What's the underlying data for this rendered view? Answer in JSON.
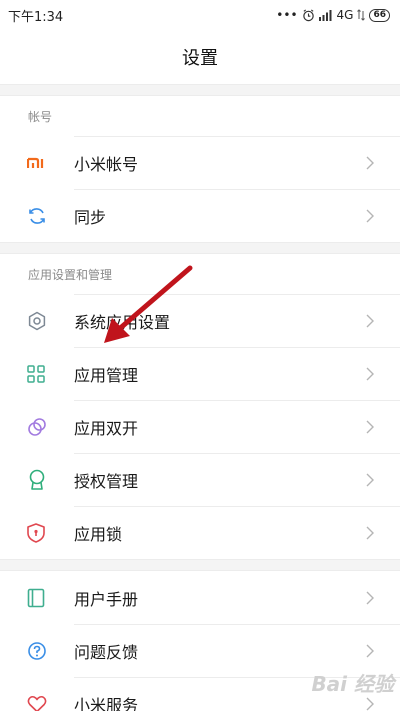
{
  "status_bar": {
    "time": "下午1:34",
    "dots": "•••",
    "network": "4G",
    "battery": "66"
  },
  "header": {
    "title": "设置"
  },
  "sections": [
    {
      "title": "帐号",
      "items": [
        {
          "label": "小米帐号",
          "icon": "mi-logo-icon",
          "color": "#f26a1b"
        },
        {
          "label": "同步",
          "icon": "sync-icon",
          "color": "#3a8ee6"
        }
      ]
    },
    {
      "title": "应用设置和管理",
      "items": [
        {
          "label": "系统应用设置",
          "icon": "gear-icon",
          "color": "#7d8894"
        },
        {
          "label": "应用管理",
          "icon": "grid-icon",
          "color": "#3fae8f"
        },
        {
          "label": "应用双开",
          "icon": "dual-circle-icon",
          "color": "#a27be0"
        },
        {
          "label": "授权管理",
          "icon": "badge-icon",
          "color": "#2fae7b"
        },
        {
          "label": "应用锁",
          "icon": "shield-lock-icon",
          "color": "#e0474f"
        }
      ]
    },
    {
      "title": "",
      "items": [
        {
          "label": "用户手册",
          "icon": "book-icon",
          "color": "#3fae8f"
        },
        {
          "label": "问题反馈",
          "icon": "question-icon",
          "color": "#3a8ee6"
        },
        {
          "label": "小米服务",
          "icon": "heart-icon",
          "color": "#e0474f"
        }
      ]
    }
  ],
  "watermark": "Bai 经验"
}
